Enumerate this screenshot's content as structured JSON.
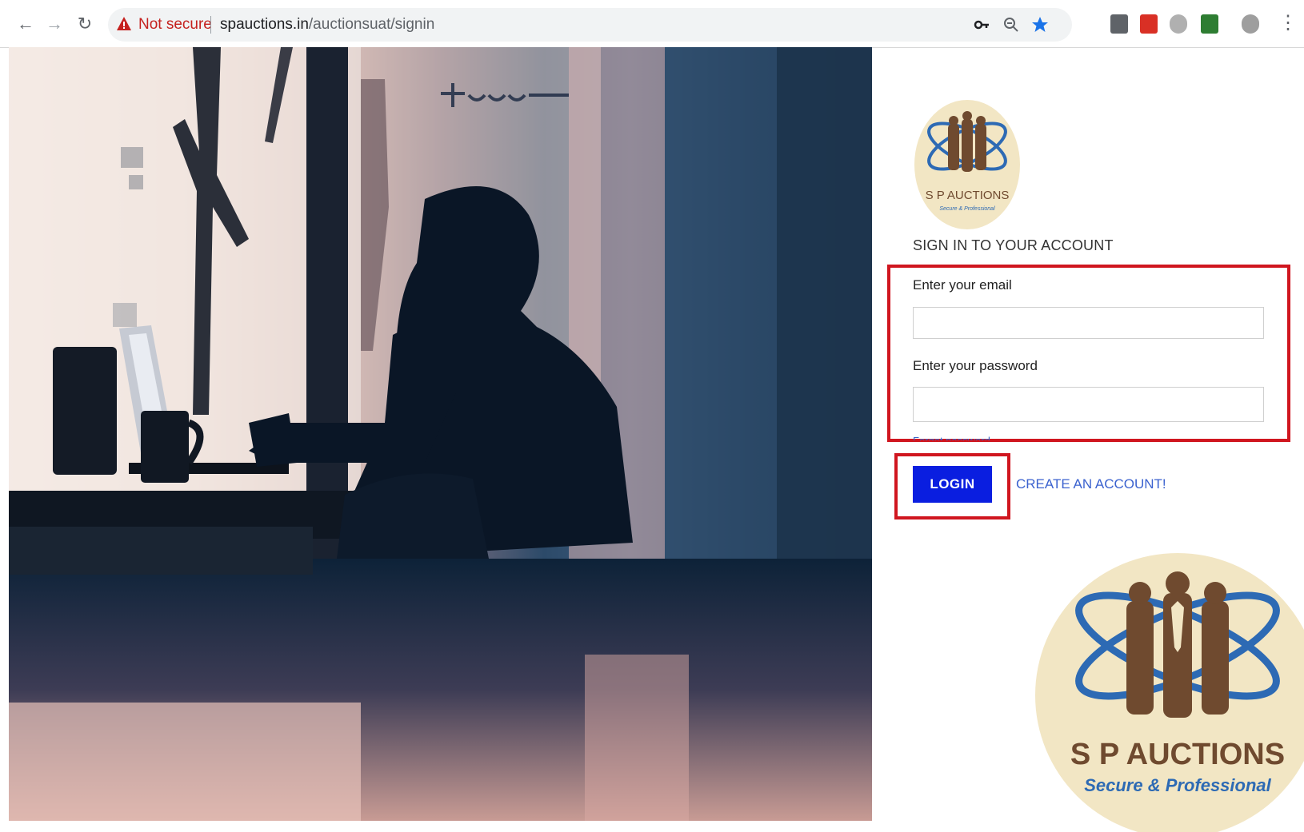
{
  "browser": {
    "security_label": "Not secure",
    "url_host": "spauctions.in",
    "url_path": "/auctionsuat/signin"
  },
  "brand": {
    "name": "S P AUCTIONS",
    "tagline": "Secure & Professional",
    "colors": {
      "gold": "#f2e6c4",
      "brown": "#6f4a2f",
      "blue": "#2d6ab4"
    }
  },
  "form": {
    "title": "SIGN IN TO YOUR ACCOUNT",
    "email_label": "Enter your email",
    "email_value": "",
    "password_label": "Enter your password",
    "password_value": "",
    "forgot_label": "Forgot password",
    "login_label": "LOGIN",
    "create_label": "CREATE AN ACCOUNT!"
  },
  "colors": {
    "highlight": "#d0161f",
    "login_button": "#0a1ee0",
    "link": "#3b62cf"
  }
}
